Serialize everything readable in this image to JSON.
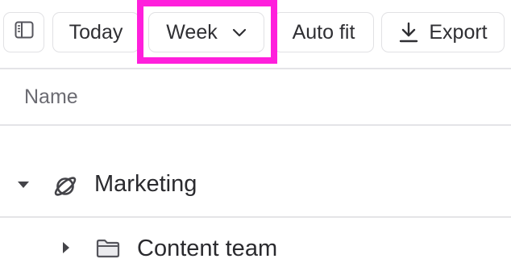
{
  "toolbar": {
    "sidebar_icon": "sidebar-toggle-icon",
    "today_label": "Today",
    "week_label": "Week",
    "week_chevron_icon": "chevron-down-icon",
    "autofit_label": "Auto fit",
    "export_icon": "download-icon",
    "export_label": "Export"
  },
  "table": {
    "column_header": "Name",
    "rows": [
      {
        "label": "Marketing",
        "icon": "planet-icon",
        "expanded": true
      },
      {
        "label": "Content team",
        "icon": "folder-icon",
        "expanded": false
      }
    ]
  },
  "colors": {
    "highlight": "#ff1fdc",
    "border": "#e1e1e4",
    "text": "#2f2f33",
    "muted_text": "#6b6b72"
  }
}
